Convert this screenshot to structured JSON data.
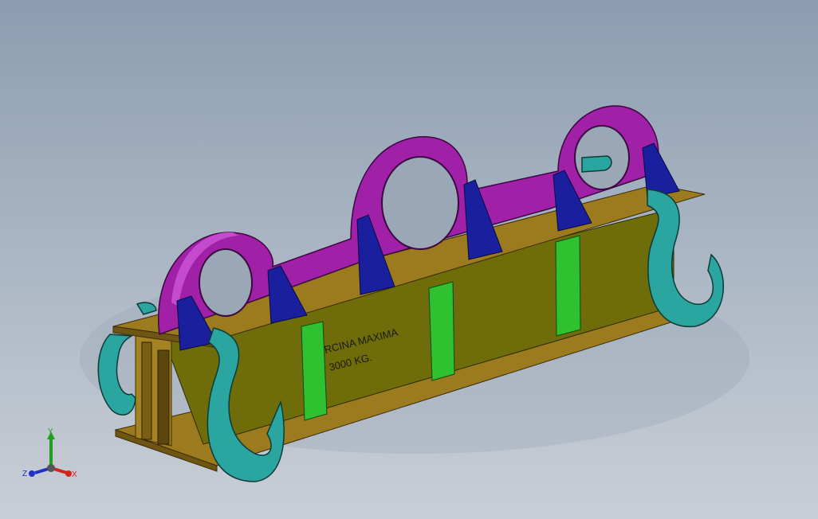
{
  "viewport": {
    "background_top": "#8c9db1",
    "background_bottom": "#c9ced6"
  },
  "model": {
    "engraving_line1": "RCINA MAXIMA",
    "engraving_line2": "3000 KG.",
    "colors": {
      "beam_flange": "#9c7a1e",
      "beam_web": "#6f6c0a",
      "stiffener": "#2fc12f",
      "lifting_lug": "#a020a8",
      "gusset": "#1a1f9e",
      "hook": "#2aa5a0"
    }
  },
  "triad": {
    "x_label": "X",
    "y_label": "Y",
    "z_label": "Z",
    "x_color": "#d0241c",
    "y_color": "#1fa022",
    "z_color": "#2030c8"
  }
}
